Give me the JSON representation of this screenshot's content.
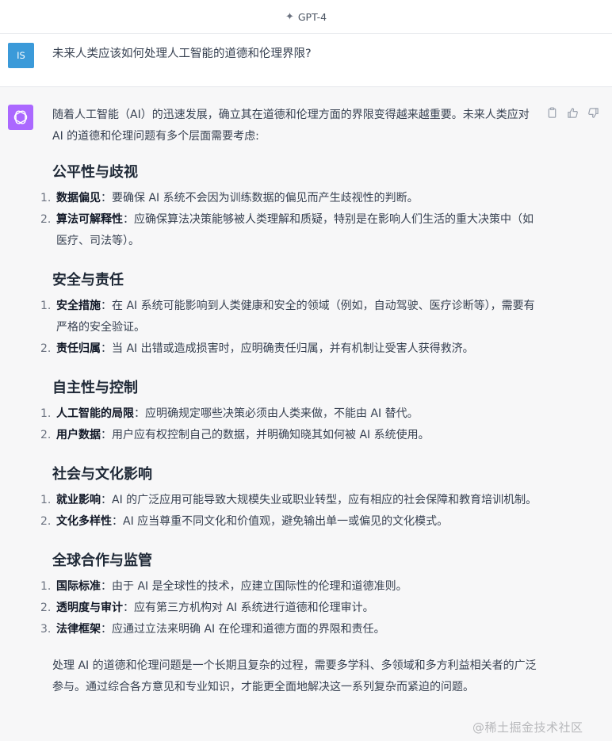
{
  "topbar": {
    "model_label": "GPT-4",
    "spark_icon": "sparkle-icon"
  },
  "user_message": {
    "avatar_initials": "IS",
    "text": "未来人类应该如何处理人工智能的道德和伦理界限?"
  },
  "assistant": {
    "intro": "随着人工智能（AI）的迅速发展，确立其在道德和伦理方面的界限变得越来越重要。未来人类应对 AI 的道德和伦理问题有多个层面需要考虑:",
    "sections": [
      {
        "heading": "公平性与歧视",
        "items": [
          {
            "num": "1.",
            "term": "数据偏见",
            "text": "：要确保 AI 系统不会因为训练数据的偏见而产生歧视性的判断。"
          },
          {
            "num": "2.",
            "term": "算法可解释性",
            "text": "：应确保算法决策能够被人类理解和质疑，特别是在影响人们生活的重大决策中（如医疗、司法等）。"
          }
        ]
      },
      {
        "heading": "安全与责任",
        "items": [
          {
            "num": "1.",
            "term": "安全措施",
            "text": "：在 AI 系统可能影响到人类健康和安全的领域（例如，自动驾驶、医疗诊断等），需要有严格的安全验证。"
          },
          {
            "num": "2.",
            "term": "责任归属",
            "text": "：当 AI 出错或造成损害时，应明确责任归属，并有机制让受害人获得救济。"
          }
        ]
      },
      {
        "heading": "自主性与控制",
        "items": [
          {
            "num": "1.",
            "term": "人工智能的局限",
            "text": "：应明确规定哪些决策必须由人类来做，不能由 AI 替代。"
          },
          {
            "num": "2.",
            "term": "用户数据",
            "text": "：用户应有权控制自己的数据，并明确知晓其如何被 AI 系统使用。"
          }
        ]
      },
      {
        "heading": "社会与文化影响",
        "items": [
          {
            "num": "1.",
            "term": "就业影响",
            "text": "：AI 的广泛应用可能导致大规模失业或职业转型，应有相应的社会保障和教育培训机制。"
          },
          {
            "num": "2.",
            "term": "文化多样性",
            "text": "：AI 应当尊重不同文化和价值观，避免输出单一或偏见的文化模式。"
          }
        ]
      },
      {
        "heading": "全球合作与监管",
        "items": [
          {
            "num": "1.",
            "term": "国际标准",
            "text": "：由于 AI 是全球性的技术，应建立国际性的伦理和道德准则。"
          },
          {
            "num": "2.",
            "term": "透明度与审计",
            "text": "：应有第三方机构对 AI 系统进行道德和伦理审计。"
          },
          {
            "num": "3.",
            "term": "法律框架",
            "text": "：应通过立法来明确 AI 在伦理和道德方面的界限和责任。"
          }
        ]
      }
    ],
    "conclusion": "处理 AI 的道德和伦理问题是一个长期且复杂的过程，需要多学科、多领域和多方利益相关者的广泛参与。通过综合各方意见和专业知识，才能更全面地解决这一系列复杂而紧迫的问题。",
    "actions": [
      "copy-icon",
      "thumbs-up-icon",
      "thumbs-down-icon"
    ]
  },
  "watermark": "@稀土掘金技术社区"
}
